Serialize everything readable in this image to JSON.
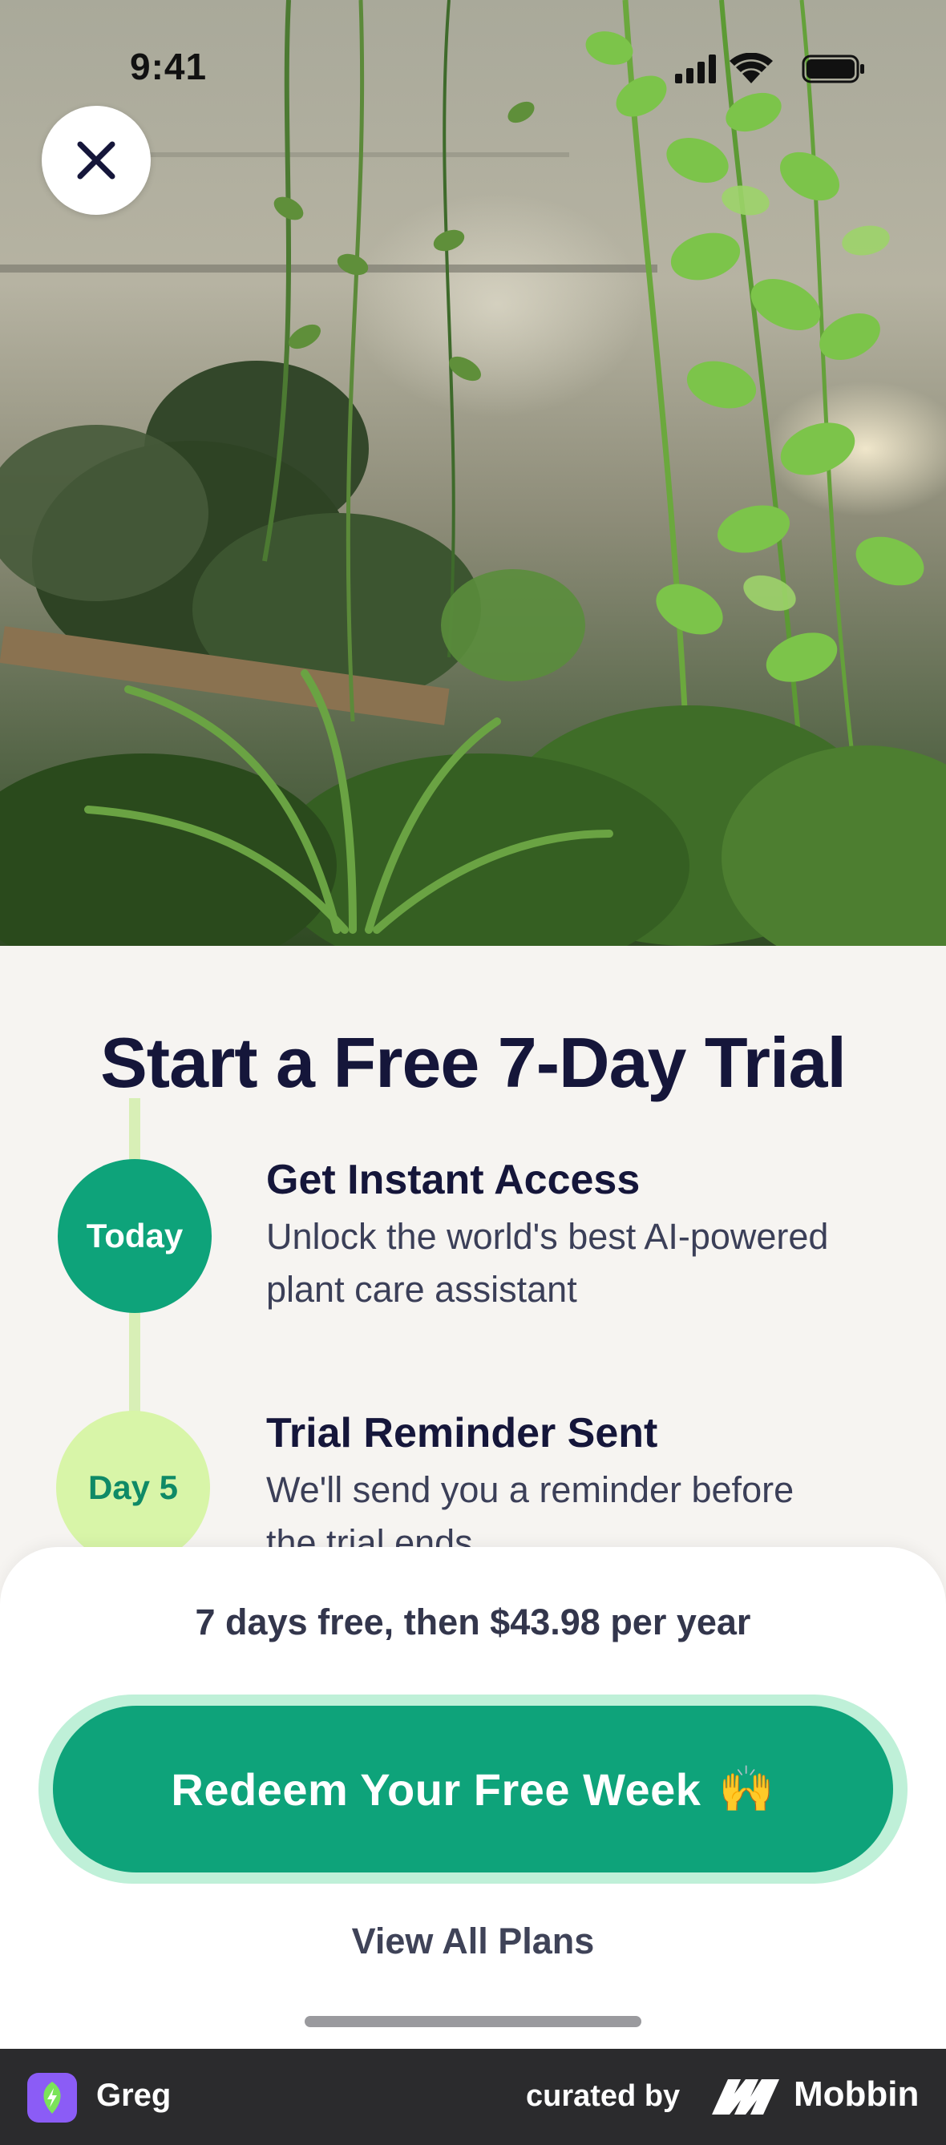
{
  "status_bar": {
    "time": "9:41",
    "icons": [
      "signal-icon",
      "wifi-icon",
      "battery-icon"
    ]
  },
  "hero": {
    "image": "hanging-plants-photo",
    "close_icon": "close-icon"
  },
  "trial": {
    "title": "Start a Free 7-Day Trial",
    "steps": [
      {
        "badge": "Today",
        "title": "Get Instant Access",
        "desc_line1": "Unlock the world's best AI-powered",
        "desc_line2": "plant care assistant"
      },
      {
        "badge": "Day 5",
        "title": "Trial Reminder Sent",
        "desc_line1": "We'll send you a reminder before",
        "desc_line2": "the trial ends"
      }
    ]
  },
  "sheet": {
    "price_text": "7 days free, then $43.98 per year",
    "cta_label": "Redeem Your Free Week",
    "cta_emoji": "🙌",
    "view_plans": "View All Plans"
  },
  "footer": {
    "app_name": "Greg",
    "curated_by": "curated by",
    "brand": "Mobbin"
  },
  "colors": {
    "accent": "#0ea37a",
    "accent_glow": "#bff0d8",
    "timeline": "#d8efb6",
    "day5_badge": "#d8f5a8",
    "title_text": "#15163a",
    "footer_bg": "#2b2b2d",
    "app_icon": "#8b5cf6"
  }
}
